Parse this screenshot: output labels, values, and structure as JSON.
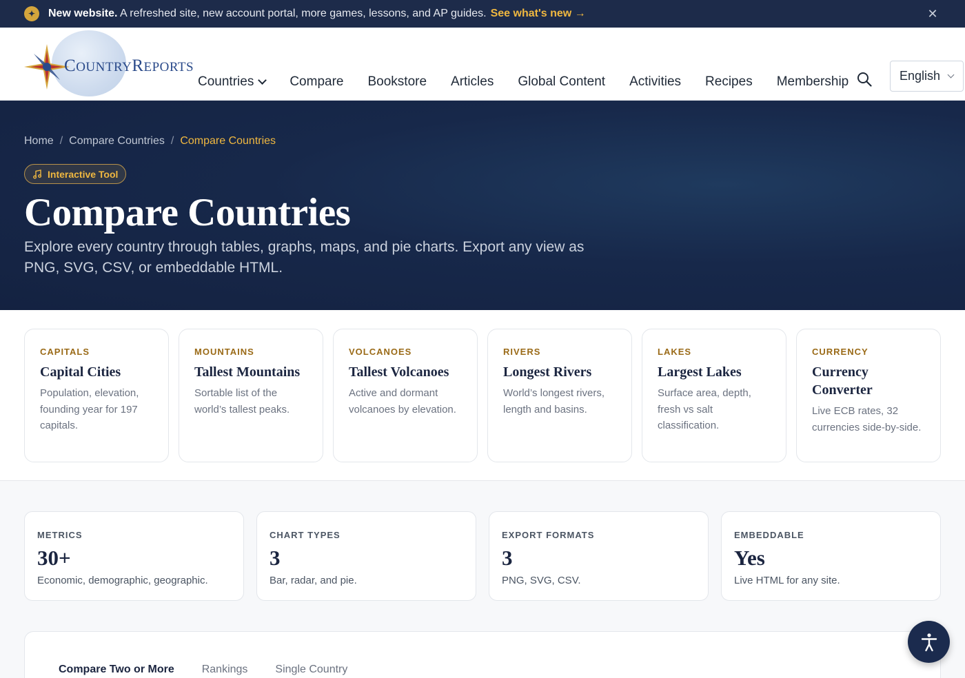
{
  "announcement": {
    "bold": "New website.",
    "text": " A refreshed site, new account portal, more games, lessons, and AP guides.",
    "link": "See what's new →",
    "close": "✕"
  },
  "header": {
    "logo": {
      "c": "C",
      "ountry": "OUNTRY",
      "r": "R",
      "eports": "EPORTS"
    },
    "nav": [
      "Countries",
      "Compare",
      "Bookstore",
      "Articles",
      "Global Content",
      "Activities",
      "Recipes",
      "Membership"
    ],
    "language": "English"
  },
  "hero": {
    "breadcrumbs": [
      "Home",
      "Compare Countries",
      "Compare Countries"
    ],
    "separator": "/",
    "pill": "Interactive Tool",
    "title": "Compare Countries",
    "lead": "Explore every country through tables, graphs, maps, and pie charts. Export any view as PNG, SVG, CSV, or embeddable HTML."
  },
  "cards": [
    {
      "kicker": "CAPITALS",
      "title": "Capital Cities",
      "desc": "Population, elevation, founding year for 197 capitals."
    },
    {
      "kicker": "MOUNTAINS",
      "title": "Tallest Mountains",
      "desc": "Sortable list of the world’s tallest peaks."
    },
    {
      "kicker": "VOLCANOES",
      "title": "Tallest Volcanoes",
      "desc": "Active and dormant volcanoes by elevation."
    },
    {
      "kicker": "RIVERS",
      "title": "Longest Rivers",
      "desc": "World’s longest rivers, length and basins."
    },
    {
      "kicker": "LAKES",
      "title": "Largest Lakes",
      "desc": "Surface area, depth, fresh vs salt classification."
    },
    {
      "kicker": "CURRENCY",
      "title": "Currency Converter",
      "desc": "Live ECB rates, 32 currencies side-by-side."
    }
  ],
  "stats": [
    {
      "label": "METRICS",
      "value": "30+",
      "sub": "Economic, demographic, geographic."
    },
    {
      "label": "CHART TYPES",
      "value": "3",
      "sub": "Bar, radar, and pie."
    },
    {
      "label": "EXPORT FORMATS",
      "value": "3",
      "sub": "PNG, SVG, CSV."
    },
    {
      "label": "EMBEDDABLE",
      "value": "Yes",
      "sub": "Live HTML for any site."
    }
  ],
  "tabs": [
    "Compare Two or More",
    "Rankings",
    "Single Country"
  ],
  "icons": {
    "announce": "star-icon",
    "close": "close-icon",
    "search": "search-icon",
    "pill": "music-note-icon",
    "fab": "accessibility-icon"
  },
  "colors": {
    "navy": "#1d2b4a",
    "gold": "#f0b840",
    "kicker": "#9a6a17",
    "hero": "#17284a"
  }
}
